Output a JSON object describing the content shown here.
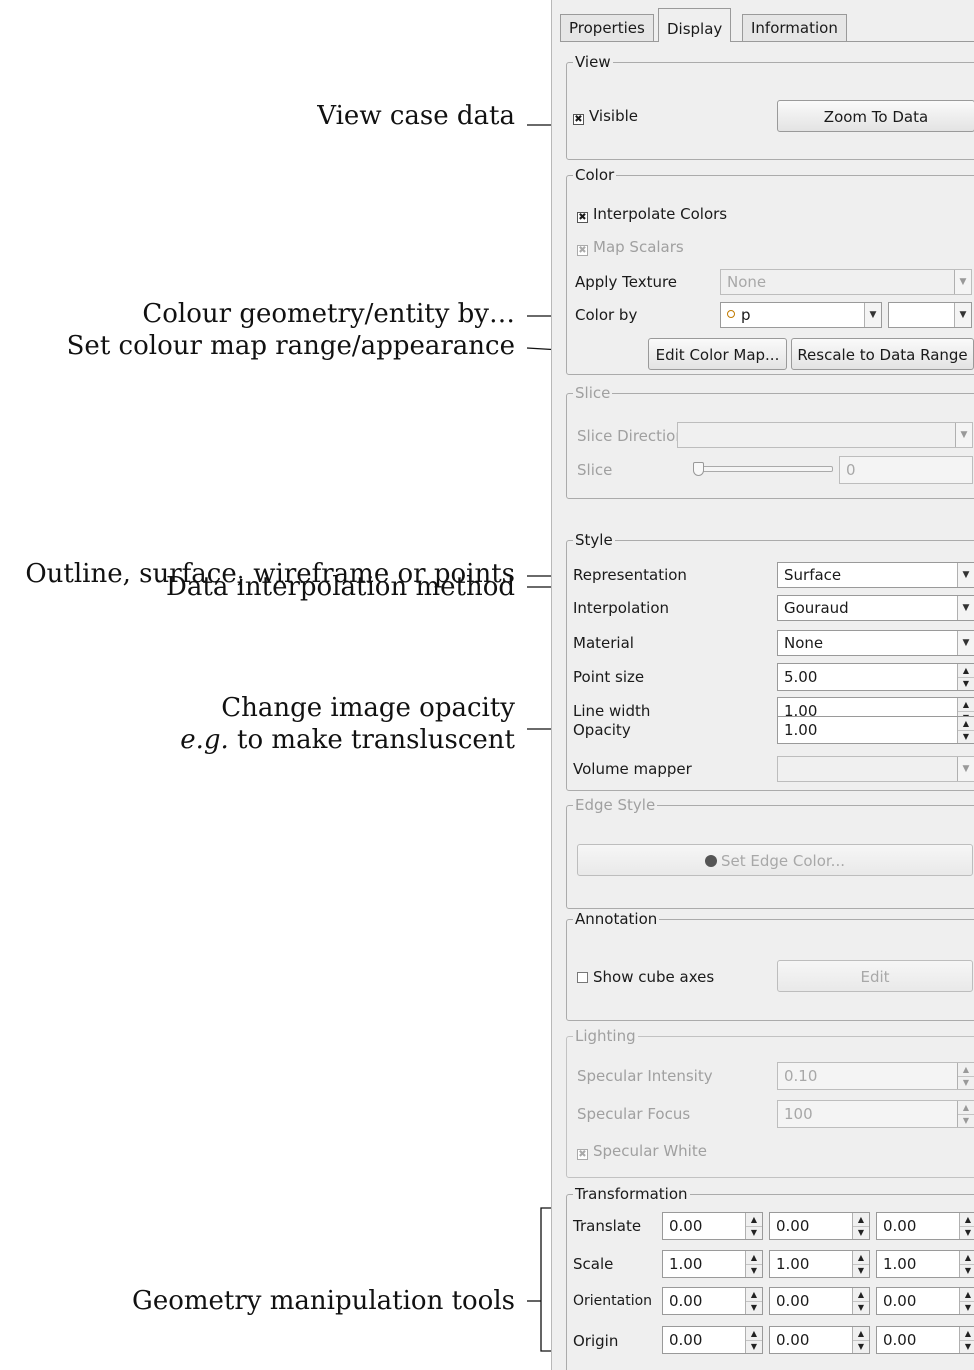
{
  "annotations": {
    "view_case_data": "View case data",
    "colour_by": "Colour geometry/entity by…",
    "colour_map": "Set colour map range/appearance",
    "representation": "Outline, surface, wireframe or points",
    "interpolation": "Data interpolation method",
    "opacity_line1": "Change image opacity",
    "opacity_line2_em": "e.g.",
    "opacity_line2_rest": " to make transluscent",
    "geometry_tools": "Geometry manipulation tools"
  },
  "tabs": [
    "Properties",
    "Display",
    "Information"
  ],
  "active_tab": "Display",
  "view": {
    "title": "View",
    "visible_label": "Visible",
    "visible_checked": true,
    "zoom_button": "Zoom To Data"
  },
  "color": {
    "title": "Color",
    "interpolate_label": "Interpolate Colors",
    "map_scalars_label": "Map Scalars",
    "apply_texture_label": "Apply Texture",
    "apply_texture_value": "None",
    "color_by_label": "Color by",
    "color_by_value": "p",
    "color_by_component": "",
    "edit_color_map_button": "Edit Color Map...",
    "rescale_button": "Rescale to Data Range"
  },
  "slice": {
    "title": "Slice",
    "direction_label": "Slice Direction",
    "direction_value": "",
    "slice_label": "Slice",
    "slice_value": "0"
  },
  "style": {
    "title": "Style",
    "representation_label": "Representation",
    "representation_value": "Surface",
    "interpolation_label": "Interpolation",
    "interpolation_value": "Gouraud",
    "material_label": "Material",
    "material_value": "None",
    "point_size_label": "Point size",
    "point_size_value": "5.00",
    "line_width_label": "Line width",
    "line_width_value": "1.00",
    "opacity_label": "Opacity",
    "opacity_value": "1.00",
    "volume_mapper_label": "Volume mapper",
    "volume_mapper_value": ""
  },
  "edge_style": {
    "title": "Edge Style",
    "button": "Set Edge Color..."
  },
  "annotation": {
    "title": "Annotation",
    "show_cube_axes_label": "Show cube axes",
    "show_cube_axes_checked": false,
    "edit_button": "Edit"
  },
  "lighting": {
    "title": "Lighting",
    "specular_intensity_label": "Specular Intensity",
    "specular_intensity_value": "0.10",
    "specular_focus_label": "Specular Focus",
    "specular_focus_value": "100",
    "specular_white_label": "Specular White"
  },
  "transformation": {
    "title": "Transformation",
    "rows": [
      {
        "label": "Translate",
        "values": [
          "0.00",
          "0.00",
          "0.00"
        ]
      },
      {
        "label": "Scale",
        "values": [
          "1.00",
          "1.00",
          "1.00"
        ]
      },
      {
        "label": "Orientation",
        "values": [
          "0.00",
          "0.00",
          "0.00"
        ]
      },
      {
        "label": "Origin",
        "values": [
          "0.00",
          "0.00",
          "0.00"
        ]
      }
    ]
  }
}
